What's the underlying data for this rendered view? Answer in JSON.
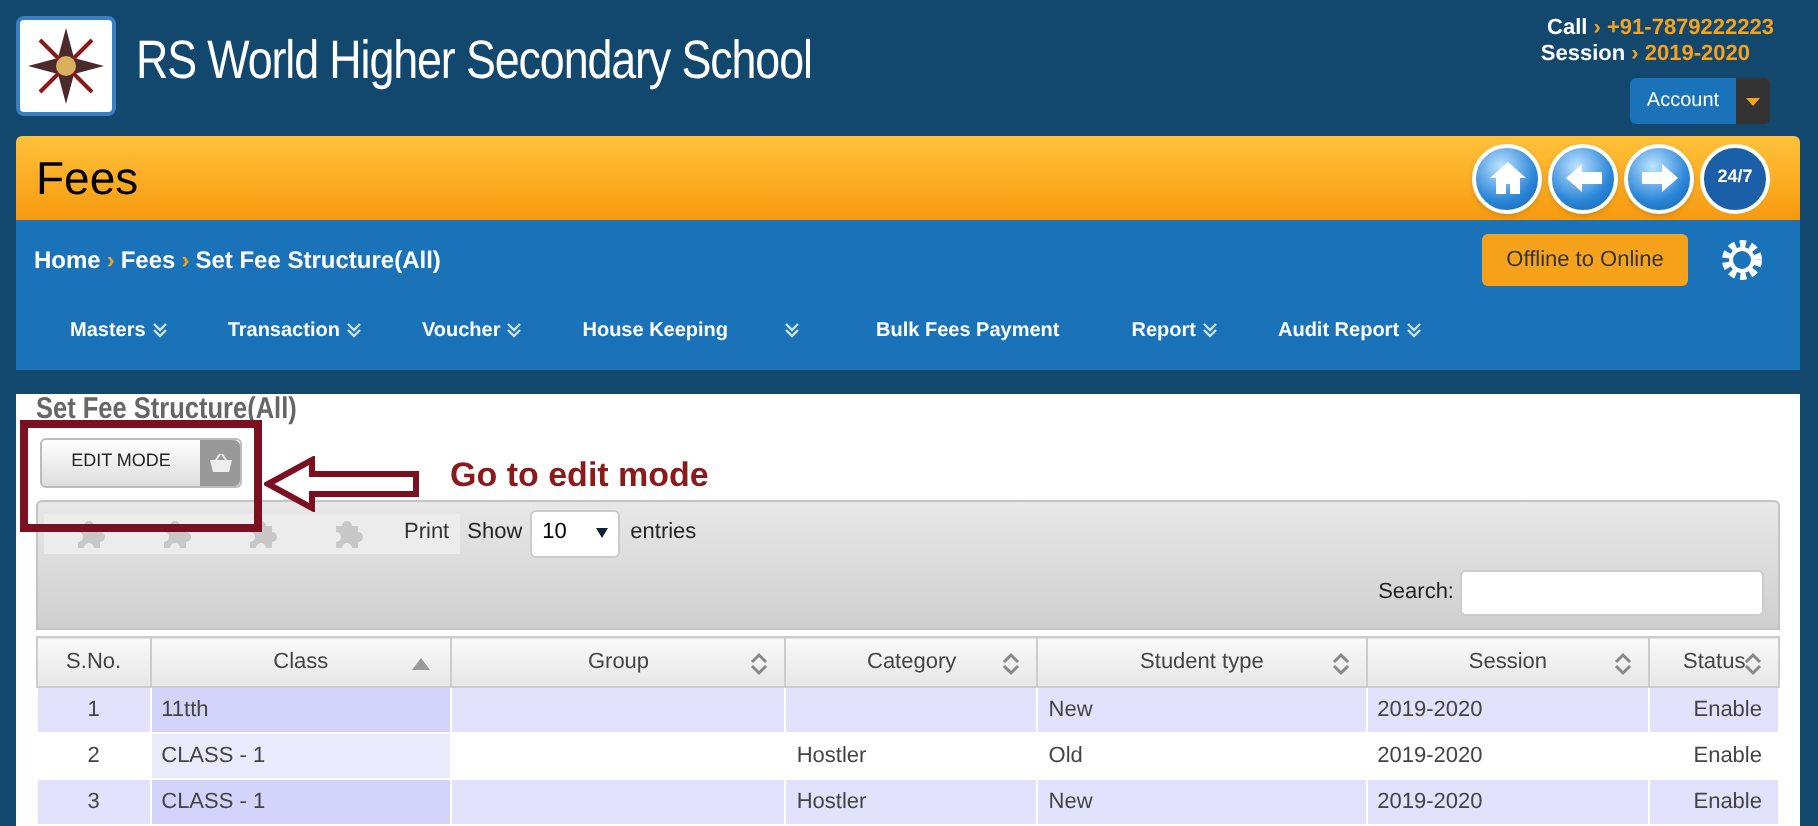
{
  "header": {
    "school_name": "RS World Higher Secondary School",
    "call_label": "Call",
    "call_separator": "›",
    "call_value": "+91-7879222223",
    "session_label": "Session",
    "session_separator": "›",
    "session_value": "2019-2020",
    "account_button": "Account"
  },
  "page_bar": {
    "title": "Fees",
    "nav_badge": "24/7"
  },
  "breadcrumb": [
    {
      "label": "Home"
    },
    {
      "separator": "›",
      "label": "Fees"
    },
    {
      "separator": "›",
      "label": "Set Fee Structure(All)"
    }
  ],
  "offline_button": "Offline to Online",
  "menu": [
    {
      "label": "Masters",
      "dropdown": true
    },
    {
      "label": "Transaction",
      "dropdown": true
    },
    {
      "label": "Voucher",
      "dropdown": true
    },
    {
      "label": "House Keeping",
      "dropdown": true
    },
    {
      "label": "Bulk Fees Payment",
      "dropdown": false
    },
    {
      "label": "Report",
      "dropdown": true
    },
    {
      "label": "Audit Report",
      "dropdown": true
    }
  ],
  "section_title": "Set Fee Structure(All)",
  "edit_mode_button": "EDIT MODE",
  "annotation": "Go to edit mode",
  "toolbar": {
    "print_button": "Print",
    "show_label": "Show",
    "page_size": "10",
    "entries_label": "entries",
    "search_label": "Search:"
  },
  "table": {
    "columns": [
      {
        "label": "S.No.",
        "sortable": false
      },
      {
        "label": "Class",
        "sortable": true,
        "sorted": true
      },
      {
        "label": "Group",
        "sortable": true,
        "sorted": false
      },
      {
        "label": "Category",
        "sortable": true,
        "sorted": false
      },
      {
        "label": "Student type",
        "sortable": true,
        "sorted": false
      },
      {
        "label": "Session",
        "sortable": true,
        "sorted": false
      },
      {
        "label": "Status",
        "sortable": true,
        "sorted": false
      }
    ],
    "rows": [
      [
        "1",
        "11tth",
        "",
        "",
        "New",
        "2019-2020",
        "Enable"
      ],
      [
        "2",
        "CLASS - 1",
        "",
        "Hostler",
        "Old",
        "2019-2020",
        "Enable"
      ],
      [
        "3",
        "CLASS - 1",
        "",
        "Hostler",
        "New",
        "2019-2020",
        "Enable"
      ]
    ]
  }
}
